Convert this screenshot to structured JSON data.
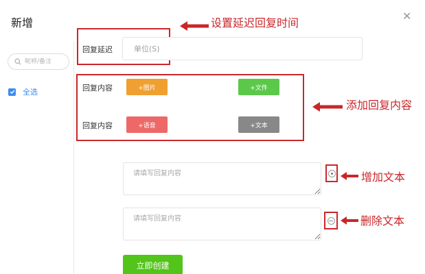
{
  "dialog": {
    "title": "新增"
  },
  "sidebar": {
    "search_placeholder": "昵称/备注",
    "select_all_label": "全选"
  },
  "delay": {
    "label": "回复延迟",
    "placeholder": "单位(S)"
  },
  "reply_content": {
    "label_1": "回复内容",
    "label_2": "回复内容",
    "buttons": {
      "image": "+图片",
      "file": "+文件",
      "voice": "+语音",
      "text": "+文本"
    }
  },
  "textareas": {
    "placeholder_1": "请填写回复内容",
    "placeholder_2": "请填写回复内容"
  },
  "actions": {
    "create_label": "立即创建"
  },
  "annotations": {
    "delay": "设置延迟回复时间",
    "content": "添加回复内容",
    "add_text": "增加文本",
    "remove_text": "删除文本"
  },
  "colors": {
    "annotation_red": "#c9262a",
    "image_orange": "#f0a030",
    "file_green": "#5cc84a",
    "voice_red": "#ee6868",
    "text_gray": "#888888",
    "create_green": "#52c41a",
    "accent_blue": "#3b8cf0"
  },
  "icons": {
    "close": "close-icon",
    "search": "search-icon",
    "check": "check-icon",
    "add": "add-circle-icon",
    "remove": "remove-circle-icon",
    "arrow": "arrow-left-icon"
  }
}
